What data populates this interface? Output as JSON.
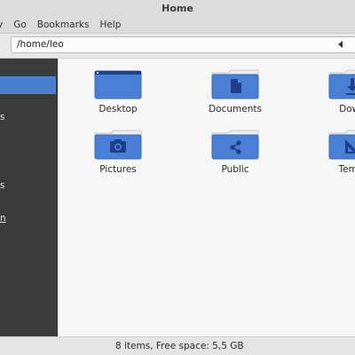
{
  "window": {
    "title": "Home"
  },
  "menu": {
    "items": [
      "y",
      "Go",
      "Bookmarks",
      "Help"
    ]
  },
  "location": {
    "path": "/home/leo"
  },
  "sidebar": {
    "items": [
      {
        "label": "",
        "selected": true
      },
      {
        "label": "s",
        "selected": false
      },
      {
        "label": "s",
        "selected": false
      },
      {
        "label": "n",
        "selected": false
      }
    ]
  },
  "files": [
    {
      "name": "Desktop",
      "icon": "desktop-folder-icon"
    },
    {
      "name": "Documents",
      "icon": "documents-folder-icon"
    },
    {
      "name": "Down",
      "icon": "downloads-folder-icon"
    },
    {
      "name": "Pictures",
      "icon": "pictures-folder-icon"
    },
    {
      "name": "Public",
      "icon": "public-folder-icon"
    },
    {
      "name": "Templ",
      "icon": "templates-folder-icon"
    }
  ],
  "status": {
    "text": "8 items, Free space: 5,5 GB"
  },
  "colors": {
    "accent": "#4a7fcd",
    "sidebar_bg": "#3b3b3b",
    "folder_blue": "#4a7fd6"
  }
}
